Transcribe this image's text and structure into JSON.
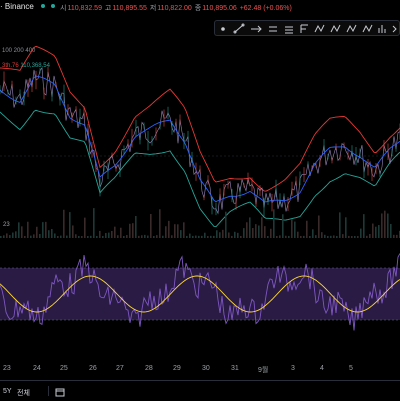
{
  "header": {
    "title": "· Binance",
    "ohlc": [
      {
        "key": "시",
        "value": "110,832.59"
      },
      {
        "key": "고",
        "value": "110,895.55"
      },
      {
        "key": "저",
        "value": "110,822.00"
      },
      {
        "key": "종",
        "value": "110,895.06"
      }
    ],
    "change": "+62.48 (+0.06%)",
    "status_color": "#26a69a"
  },
  "indicators": {
    "line1": "100 200 400",
    "line2_prefix": "3th.76",
    "line2_value": "110,368.54"
  },
  "toolbar": {
    "icons": [
      "pen-line-icon",
      "arrow-icon",
      "arrow-right-icon",
      "text-icon",
      "wave-icon",
      "wave2-icon",
      "zigzag-icon",
      "zigzag2-icon",
      "brush-icon",
      "ruler-icon",
      "bars-icon",
      "more-icon"
    ]
  },
  "volume": {
    "label_left": "23"
  },
  "xaxis": {
    "ticks": [
      "23",
      "24",
      "25",
      "26",
      "27",
      "28",
      "29",
      "30",
      "31",
      "9월",
      "3",
      "4",
      "5"
    ]
  },
  "footer": {
    "range_5y": "5Y",
    "range_all": "전체"
  },
  "colors": {
    "up": "#26a69a",
    "down": "#ef5350",
    "bb_upper": "#e53935",
    "bb_lower": "#26a69a",
    "ma": "#2962ff",
    "price": "#b39ddb",
    "rsi": "#7e57c2",
    "rsi_ma": "#fdd835",
    "rsi_band": "#2a1b45"
  }
}
